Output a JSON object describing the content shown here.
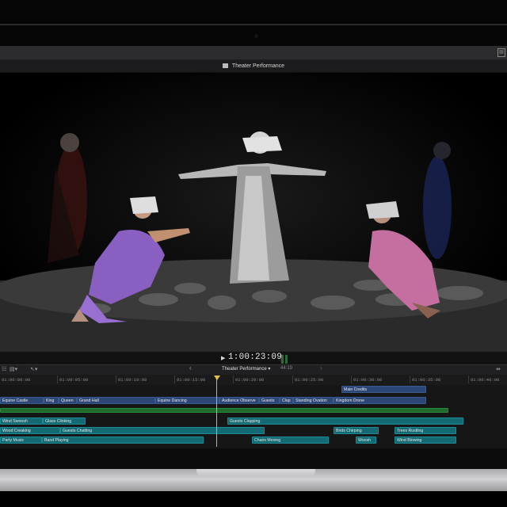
{
  "viewer": {
    "title": "Theater Performance",
    "timecode": "1:00:23:09"
  },
  "timeline": {
    "project_name": "Theater Performance",
    "duration": "44:19",
    "ruler": [
      "01:00:00:00",
      "01:00:05:00",
      "01:00:10:00",
      "01:00:15:00",
      "01:00:20:00",
      "01:00:25:00",
      "01:00:30:00",
      "01:00:35:00",
      "01:00:40:00"
    ],
    "title_clips": [
      "Main Credits"
    ],
    "video_clips": [
      "Equine Castle",
      "King",
      "Queen",
      "Grand Hall",
      "Equine Dancing",
      "Audience Observe",
      "Guests",
      "Clap",
      "Standing Ovation",
      "Kingdom Drone"
    ],
    "audio_row1": [
      "Wind Swoosh",
      "Glass Clinking",
      "Guests Clapping"
    ],
    "audio_row2": [
      "Wood Creaking",
      "Guests Chatting",
      "Birds Chirping",
      "Trees Rustling"
    ],
    "audio_row3": [
      "Party Music",
      "Band Playing",
      "Chairs Moving",
      "Woosh",
      "Wind Blowing"
    ]
  },
  "colors": {
    "playhead": "#e3bf45",
    "video_clip": "#2c4777",
    "audio_clip": "#136a73",
    "music_bar": "#1f6b2e"
  }
}
